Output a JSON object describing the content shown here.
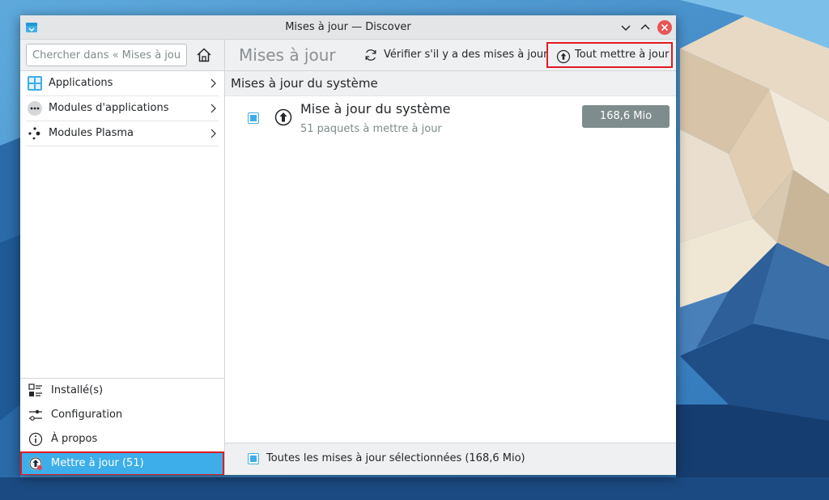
{
  "window": {
    "title": "Mises à jour — Discover"
  },
  "sidebar": {
    "search_placeholder": "Chercher dans « Mises à jou...",
    "categories": [
      {
        "label": "Applications",
        "icon": "applications-grid-icon"
      },
      {
        "label": "Modules d'applications",
        "icon": "addons-dots-icon"
      },
      {
        "label": "Modules Plasma",
        "icon": "plasma-icon"
      }
    ],
    "bottom": [
      {
        "label": "Installé(s)",
        "icon": "installed-list-icon"
      },
      {
        "label": "Configuration",
        "icon": "settings-sliders-icon"
      },
      {
        "label": "À propos",
        "icon": "info-icon"
      },
      {
        "label": "Mettre à jour (51)",
        "icon": "update-icon",
        "active": true
      }
    ]
  },
  "toolbar": {
    "page_title": "Mises à jour",
    "check_updates_label": "Vérifier s'il y a des mises à jour",
    "update_all_label": "Tout mettre à jour"
  },
  "main": {
    "section_title": "Mises à jour du système",
    "update_item": {
      "title": "Mise à jour du système",
      "subtitle": "51 paquets à mettre à jour",
      "size": "168,6 Mio",
      "checked": true
    },
    "footer_label": "Toutes les mises à jour sélectionnées (168,6 Mio)",
    "footer_checked": true
  },
  "colors": {
    "accent": "#3daee9",
    "highlight_border": "#e01b24",
    "badge": "#7f8c8d",
    "close_button": "#e95455"
  }
}
